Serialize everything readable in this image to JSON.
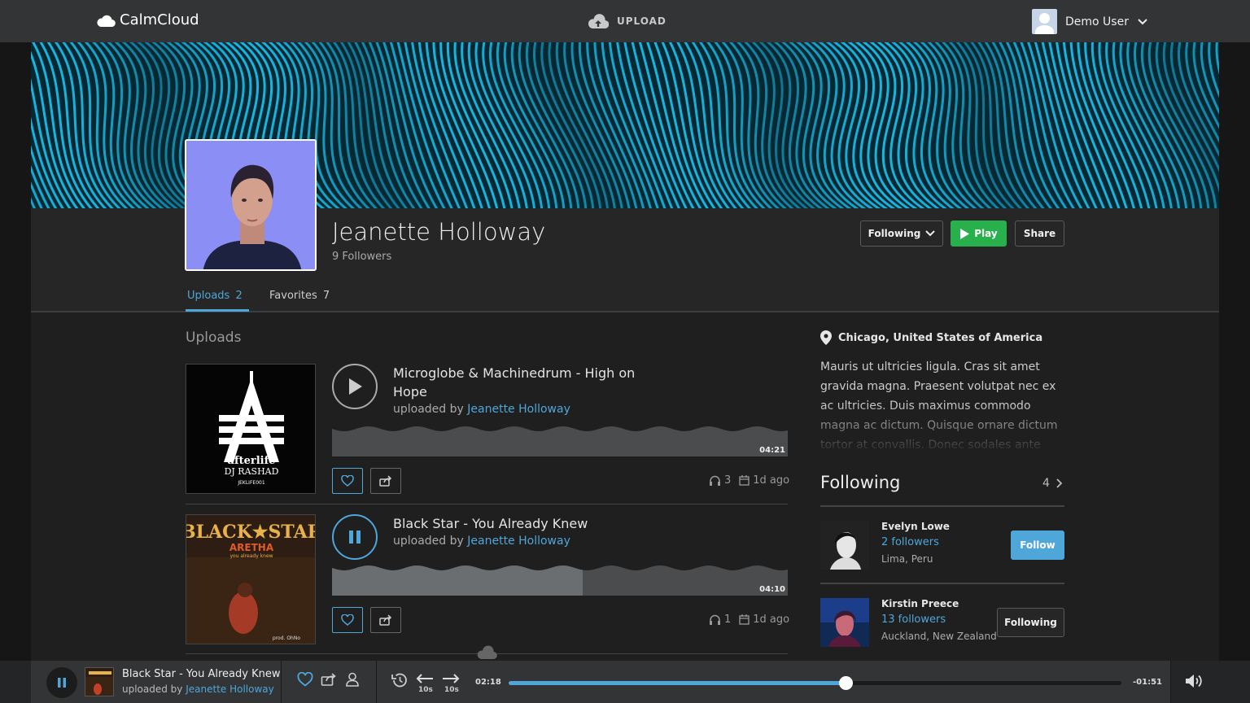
{
  "header": {
    "brand": "CalmCloud",
    "upload_label": "UPLOAD",
    "user_name": "Demo User"
  },
  "profile": {
    "name": "Jeanette Holloway",
    "followers": "9 Followers"
  },
  "actions": {
    "following": "Following",
    "play": "Play",
    "share": "Share"
  },
  "tabs": [
    {
      "label": "Uploads",
      "count": "2"
    },
    {
      "label": "Favorites",
      "count": "7"
    }
  ],
  "uploads": {
    "section_title": "Uploads",
    "tracks": [
      {
        "title": "Microglobe & Machinedrum - High on Hope",
        "uploaded_by_prefix": "uploaded by",
        "uploader": "Jeanette Holloway",
        "duration": "04:21",
        "plays": "3",
        "age": "1d ago",
        "art_lines": [
          "afterlife",
          "DJ RASHAD",
          "JEKLIFE001"
        ],
        "state": "paused",
        "progress": 0
      },
      {
        "title": "Black Star - You Already Knew",
        "uploaded_by_prefix": "uploaded by",
        "uploader": "Jeanette Holloway",
        "duration": "04:10",
        "plays": "1",
        "age": "1d ago",
        "art_lines": [
          "BLACK★STAR",
          "ARETHA",
          "you already knew",
          "prod. OhNo"
        ],
        "state": "playing",
        "progress": 0.55
      }
    ]
  },
  "sidebar": {
    "location": "Chicago, United States of America",
    "bio": "Mauris ut ultricies ligula. Cras sit amet gravida magna. Praesent volutpat nec ex ac ultricies. Duis maximus commodo magna ac dictum. Quisque ornare dictum tortor at convallis. Donec sodales ante ullamcorper molestie",
    "following_title": "Following",
    "following_count": "4",
    "following": [
      {
        "name": "Evelyn Lowe",
        "followers": "2 followers",
        "location": "Lima, Peru",
        "button": "Follow"
      },
      {
        "name": "Kirstin Preece",
        "followers": "13 followers",
        "location": "Auckland, New Zealand",
        "button": "Following"
      }
    ]
  },
  "player": {
    "title": "Black Star - You Already Knew",
    "uploaded_by_prefix": "uploaded by",
    "uploader": "Jeanette Holloway",
    "elapsed": "02:18",
    "remaining": "-01:51",
    "skip_back": "10s",
    "skip_fwd": "10s",
    "progress": 0.55
  },
  "colors": {
    "accent": "#4ea6d9",
    "play_green": "#27b04b",
    "banner": "#18b4de"
  }
}
